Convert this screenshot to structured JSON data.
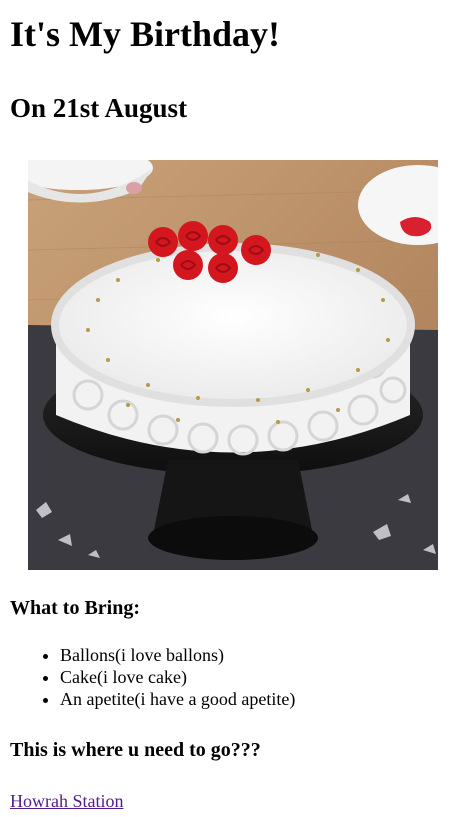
{
  "page": {
    "title": "It's My Birthday!",
    "date_heading": "On 21st August",
    "image_alt": "Birthday cake",
    "bring_heading": "What to Bring:",
    "bring_items": [
      "Ballons(i love ballons)",
      "Cake(i love cake)",
      "An apetite(i have a good apetite)"
    ],
    "go_heading": "This is where u need to go???",
    "link_text": "Howrah Station"
  },
  "colors": {
    "link_visited": "#551a8b",
    "text": "#000000",
    "background": "#ffffff"
  }
}
